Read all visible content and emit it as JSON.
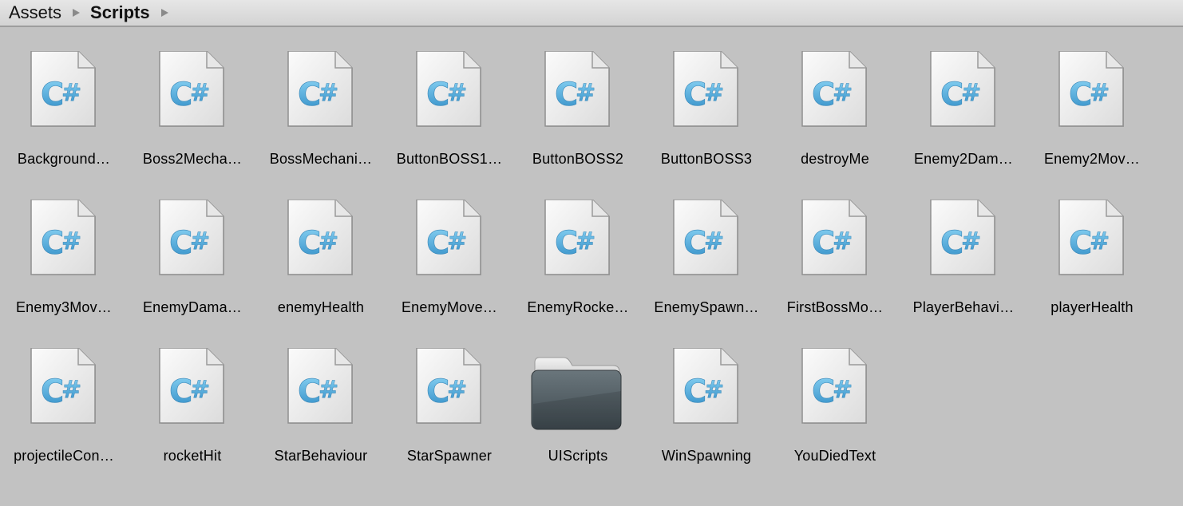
{
  "breadcrumb": {
    "items": [
      "Assets",
      "Scripts"
    ]
  },
  "icons": {
    "script": "csharp-script-icon",
    "folder": "folder-icon"
  },
  "assets": [
    {
      "label": "Background…",
      "type": "script"
    },
    {
      "label": "Boss2Mecha…",
      "type": "script"
    },
    {
      "label": "BossMechani…",
      "type": "script"
    },
    {
      "label": "ButtonBOSS1…",
      "type": "script"
    },
    {
      "label": "ButtonBOSS2",
      "type": "script"
    },
    {
      "label": "ButtonBOSS3",
      "type": "script"
    },
    {
      "label": "destroyMe",
      "type": "script"
    },
    {
      "label": "Enemy2Dam…",
      "type": "script"
    },
    {
      "label": "Enemy2Mov…",
      "type": "script"
    },
    {
      "label": "Enemy3Mov…",
      "type": "script"
    },
    {
      "label": "EnemyDama…",
      "type": "script"
    },
    {
      "label": "enemyHealth",
      "type": "script"
    },
    {
      "label": "EnemyMove…",
      "type": "script"
    },
    {
      "label": "EnemyRocke…",
      "type": "script"
    },
    {
      "label": "EnemySpawn…",
      "type": "script"
    },
    {
      "label": "FirstBossMo…",
      "type": "script"
    },
    {
      "label": "PlayerBehavi…",
      "type": "script"
    },
    {
      "label": "playerHealth",
      "type": "script"
    },
    {
      "label": "projectileCon…",
      "type": "script"
    },
    {
      "label": "rocketHit",
      "type": "script"
    },
    {
      "label": "StarBehaviour",
      "type": "script"
    },
    {
      "label": "StarSpawner",
      "type": "script"
    },
    {
      "label": "UIScripts",
      "type": "folder"
    },
    {
      "label": "WinSpawning",
      "type": "script"
    },
    {
      "label": "YouDiedText",
      "type": "script"
    }
  ]
}
